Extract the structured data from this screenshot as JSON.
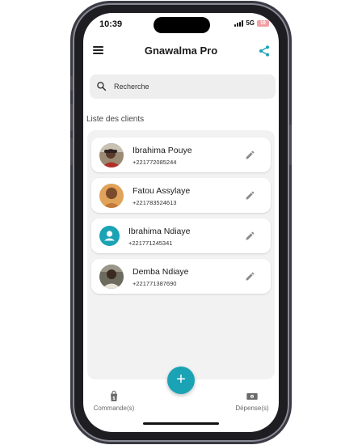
{
  "status_bar": {
    "time": "10:39",
    "network": "5G",
    "battery": "19"
  },
  "app_bar": {
    "title": "Gnawalma Pro"
  },
  "search": {
    "placeholder": "Recherche"
  },
  "section": {
    "title": "Liste des clients"
  },
  "clients": [
    {
      "name": "Ibrahima Pouye",
      "phone": "+221772085244",
      "avatar": "photo"
    },
    {
      "name": "Fatou Assylaye",
      "phone": "+221783524613",
      "avatar": "photo"
    },
    {
      "name": "Ibrahima Ndiaye",
      "phone": "+221771245341",
      "avatar": "person-icon"
    },
    {
      "name": "Demba Ndiaye",
      "phone": "+221771387690",
      "avatar": "photo"
    }
  ],
  "fab": {
    "label": "+"
  },
  "bottom_nav": {
    "orders_label": "Commande(s)",
    "expenses_label": "Dépense(s)"
  },
  "colors": {
    "accent": "#1aa3b5",
    "background": "#f2f2f2"
  }
}
